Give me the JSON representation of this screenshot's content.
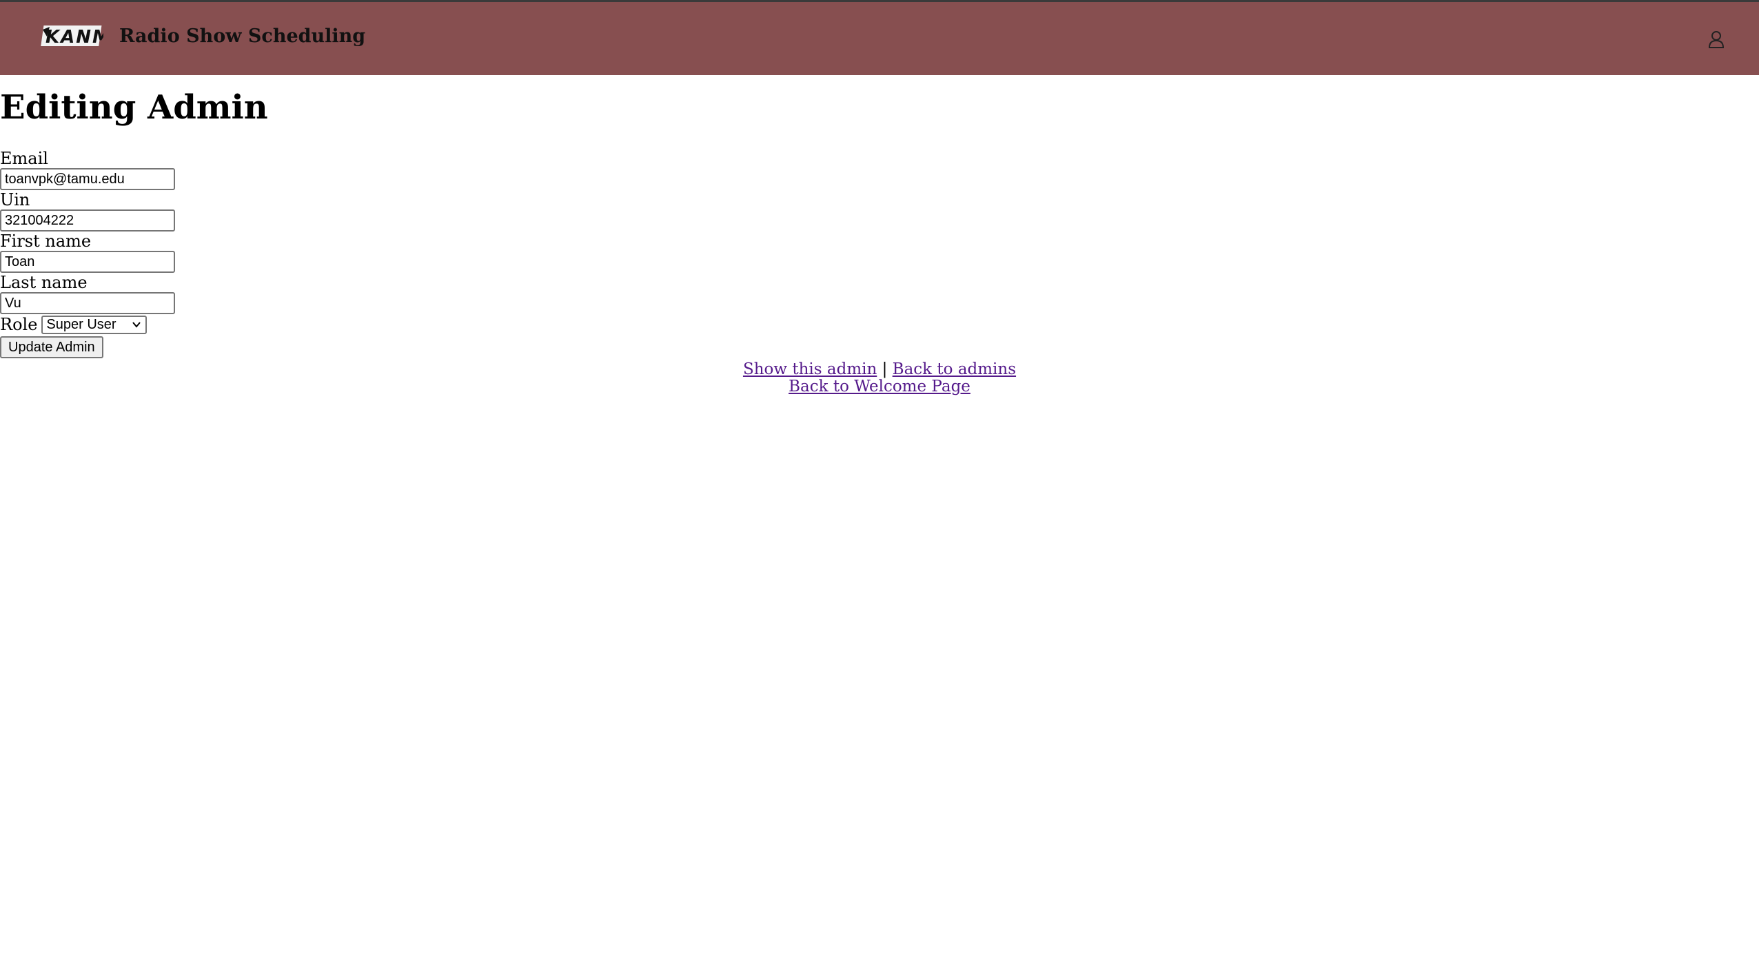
{
  "header": {
    "logo_text": "KANM",
    "app_title": "Radio Show Scheduling",
    "user_icon": "user-icon",
    "bar_color": "#874f50"
  },
  "page": {
    "title": "Editing Admin"
  },
  "form": {
    "email_label": "Email",
    "email_value": "toanvpk@tamu.edu",
    "uin_label": "Uin",
    "uin_value": "321004222",
    "first_name_label": "First name",
    "first_name_value": "Toan",
    "last_name_label": "Last name",
    "last_name_value": "Vu",
    "role_label": "Role",
    "role_value": "Super User",
    "submit_label": "Update Admin"
  },
  "links": {
    "show_admin": "Show this admin",
    "separator": "|",
    "back_to_admins": "Back to admins",
    "back_to_welcome": "Back to Welcome Page",
    "link_color": "#551a8b"
  }
}
